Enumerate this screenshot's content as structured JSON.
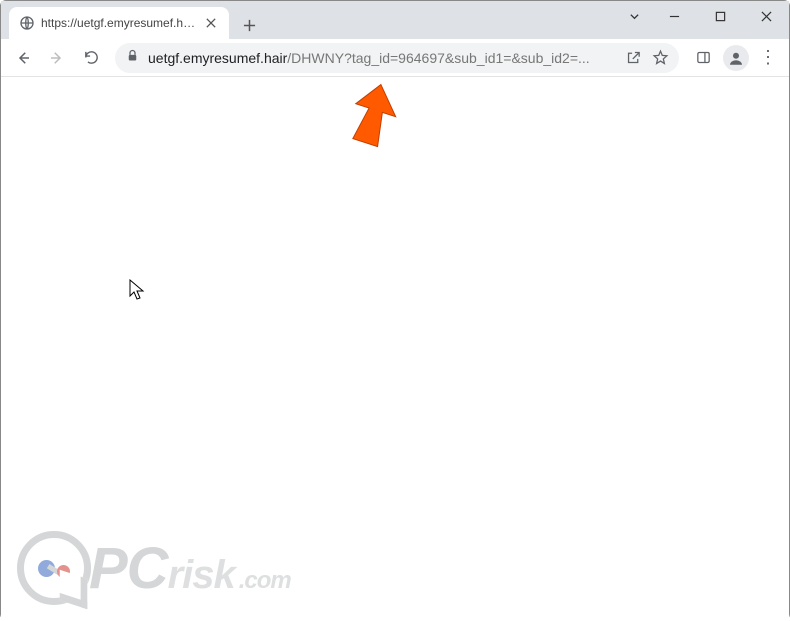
{
  "window": {
    "tab_title": "https://uetgf.emyresumef.hair/DH"
  },
  "toolbar": {
    "url_host": "uetgf.emyresumef.hair",
    "url_path": "/DHWNY?tag_id=964697&sub_id1=&sub_id2=..."
  },
  "watermark": {
    "brand_pc": "PC",
    "brand_risk": "risk",
    "brand_com": ".com"
  }
}
